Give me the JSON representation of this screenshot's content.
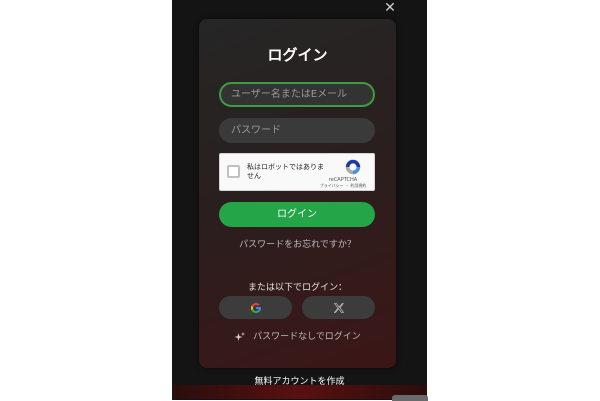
{
  "dialog": {
    "close_glyph": "✕",
    "title": "ログイン",
    "username_placeholder": "ユーザー名またはEメール",
    "password_placeholder": "パスワード",
    "recaptcha": {
      "label": "私はロボットではありません",
      "brand": "reCAPTCHA",
      "terms": "プライバシー ・ 利用規約"
    },
    "login_button": "ログイン",
    "forgot_password": "パスワードをお忘れですか？",
    "or_login_with": "または以下でログイン：",
    "social": [
      {
        "name": "Google",
        "icon": "google-icon"
      },
      {
        "name": "X",
        "icon": "x-icon"
      }
    ],
    "passwordless_login": "パスワードなしでログイン",
    "create_account": "無料アカウントを作成"
  },
  "colors": {
    "accent_green": "#23a548",
    "focus_border": "#3f9b3f",
    "modal_bg": "#262626"
  }
}
